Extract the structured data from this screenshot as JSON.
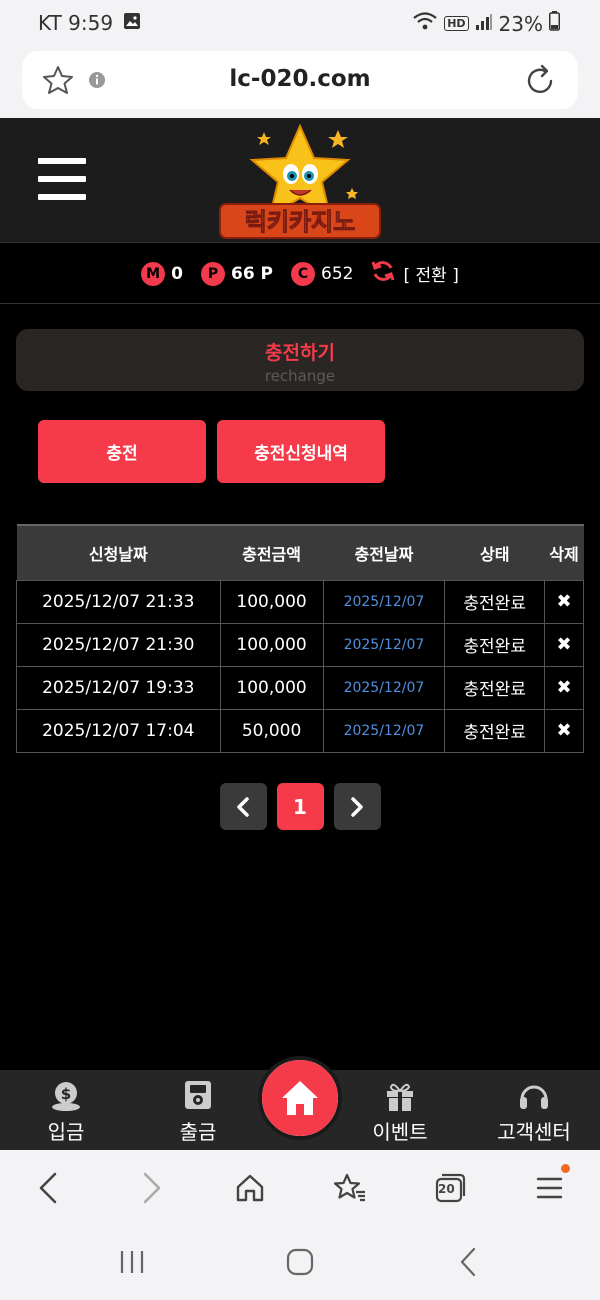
{
  "status": {
    "carrier_time": "KT 9:59",
    "battery": "23%"
  },
  "browser": {
    "url": "lc-020.com",
    "tab_count": "20"
  },
  "points": {
    "m_badge": "M",
    "m_value": "0",
    "p_badge": "P",
    "p_value": "66 P",
    "c_badge": "C",
    "c_value": "652",
    "convert_label": "[ 전환 ]"
  },
  "section": {
    "title": "충전하기",
    "subtitle": "rechange"
  },
  "buttons": {
    "charge": "충전",
    "history": "충전신청내역"
  },
  "table": {
    "headers": [
      "신청날짜",
      "충전금액",
      "충전날짜",
      "상태",
      "삭제"
    ],
    "rows": [
      {
        "req_date": "2025/12/07 21:33",
        "amount": "100,000",
        "done_date": "2025/12/07",
        "status": "충전완료",
        "delete": "✖"
      },
      {
        "req_date": "2025/12/07 21:30",
        "amount": "100,000",
        "done_date": "2025/12/07",
        "status": "충전완료",
        "delete": "✖"
      },
      {
        "req_date": "2025/12/07 19:33",
        "amount": "100,000",
        "done_date": "2025/12/07",
        "status": "충전완료",
        "delete": "✖"
      },
      {
        "req_date": "2025/12/07 17:04",
        "amount": "50,000",
        "done_date": "2025/12/07",
        "status": "충전완료",
        "delete": "✖"
      }
    ]
  },
  "pagination": {
    "prev": "‹",
    "current": "1",
    "next": "›"
  },
  "bottom_nav": {
    "deposit": "입금",
    "withdraw": "출금",
    "event": "이벤트",
    "support": "고객센터"
  },
  "colors": {
    "accent": "#f53a4a",
    "header_bg": "#1c1c1c",
    "link_blue": "#4f8fdd"
  }
}
